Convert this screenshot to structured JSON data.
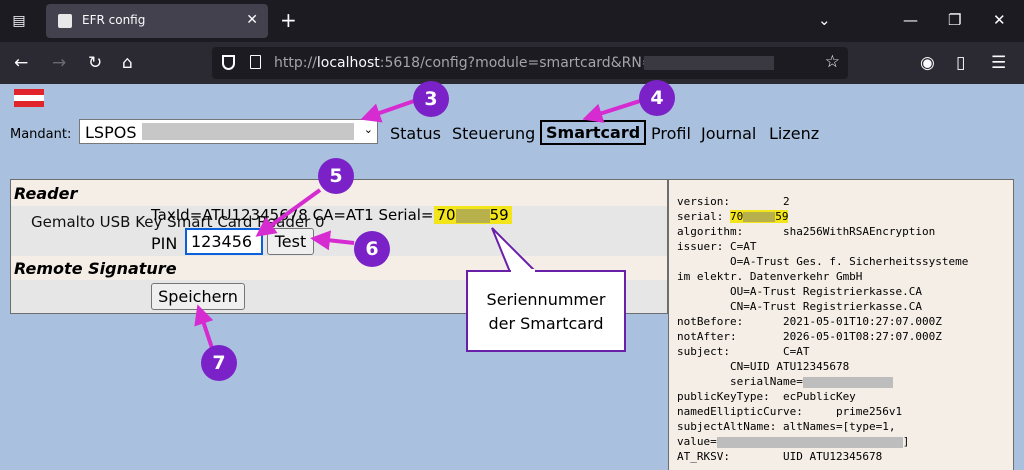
{
  "browser": {
    "tab_title": "EFR config",
    "url_prefix": "http://",
    "url_host": "localhost",
    "url_rest": ":5618/config?module=smartcard&RN=LSPOS"
  },
  "page": {
    "mandant_label": "Mandant:",
    "mandant_value": "LSPOS",
    "nav": [
      "Status",
      "Steuerung",
      "Smartcard",
      "Profil",
      "Journal",
      "Lizenz"
    ],
    "active_nav": "Smartcard",
    "reader_heading": "Reader",
    "device_label": "Gemalto USB Key Smart Card Reader 0",
    "taxid_text": "TaxId=ATU12345678 CA=AT1 Serial=",
    "serial_start": "70",
    "serial_end": "59",
    "pin_label": "PIN",
    "pin_value": "123456",
    "test_button": "Test",
    "remote_heading": "Remote Signature",
    "save_button": "Speichern"
  },
  "callout": {
    "line1": "Seriennummer",
    "line2": "der Smartcard"
  },
  "markers": [
    "3",
    "4",
    "5",
    "6",
    "7"
  ],
  "cert": {
    "version": "version:        2",
    "serial_label": "serial: ",
    "serial_start": "70",
    "serial_end": "59",
    "algorithm": "algorithm:      sha256WithRSAEncryption",
    "issuer1": "issuer: C=AT",
    "issuer2": "        O=A-Trust Ges. f. Sicherheitssysteme",
    "issuer3": "im elektr. Datenverkehr GmbH",
    "issuer4": "        OU=A-Trust Registrierkasse.CA",
    "issuer5": "        CN=A-Trust Registrierkasse.CA",
    "notBefore": "notBefore:      2021-05-01T10:27:07.000Z",
    "notAfter": "notAfter:       2026-05-01T08:27:07.000Z",
    "subject1": "subject:        C=AT",
    "subject2": "        CN=UID ATU12345678",
    "subject3": "        serialName=",
    "publicKeyType": "publicKeyType:  ecPublicKey",
    "curve": "namedEllipticCurve:     prime256v1",
    "altname1": "subjectAltName: altNames=[type=1,",
    "altname2": "value=",
    "altname2_end": "]",
    "rksv": "AT_RKSV:        UID ATU12345678"
  },
  "colors": {
    "page_bg": "#a9c0df",
    "highlight": "#f2e61a",
    "marker": "#7b21c8",
    "arrow": "#d62bd0"
  }
}
